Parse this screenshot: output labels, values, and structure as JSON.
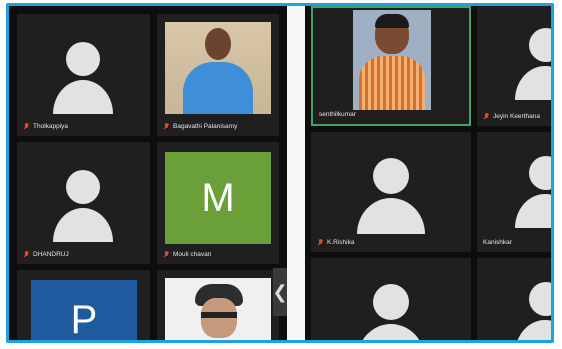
{
  "participants": {
    "left": [
      {
        "name": "Tholkappiya",
        "muted": true,
        "type": "avatar"
      },
      {
        "name": "Bagavathi Palanisamy",
        "muted": true,
        "type": "photo"
      },
      {
        "name": "DHANDRUJ",
        "muted": true,
        "type": "avatar"
      },
      {
        "name": "Mouli chavan",
        "muted": true,
        "type": "letter",
        "letter": "M",
        "color": "#6a9f3a"
      },
      {
        "name": "",
        "muted": false,
        "type": "letter",
        "letter": "P",
        "color": "#1f5a9e"
      },
      {
        "name": "",
        "muted": false,
        "type": "photo"
      }
    ],
    "right": [
      {
        "name": "senthilkumar",
        "muted": false,
        "type": "photo",
        "active": true
      },
      {
        "name": "Jeyin Keerthana",
        "muted": true,
        "type": "avatar"
      },
      {
        "name": "K.Rishika",
        "muted": true,
        "type": "avatar"
      },
      {
        "name": "Kanishkar",
        "muted": false,
        "type": "avatar"
      },
      {
        "name": "",
        "muted": false,
        "type": "avatar"
      },
      {
        "name": "",
        "muted": false,
        "type": "avatar"
      }
    ]
  },
  "nav": {
    "next_icon": "chevron-right-icon",
    "next_glyph": "❮"
  },
  "colors": {
    "border": "#1aa3e0",
    "active_tile": "#3fa36a",
    "mic_muted": "#e8433b"
  }
}
